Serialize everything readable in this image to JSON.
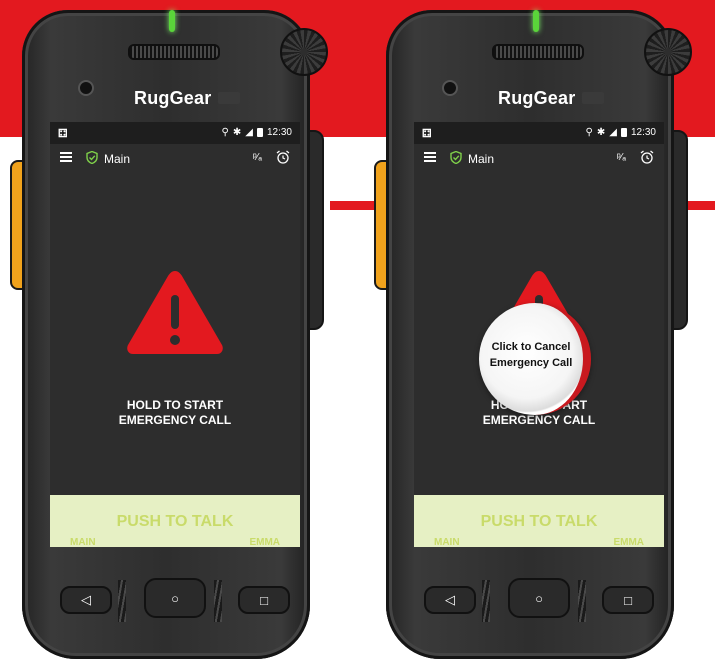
{
  "brand": "RugGear",
  "status_bar": {
    "left_icon": "⚃",
    "time": "12:30"
  },
  "app_bar": {
    "title": "Main"
  },
  "emergency": {
    "hold_text_line1": "HOLD TO START",
    "hold_text_line2": "EMERGENCY CALL"
  },
  "cancel": {
    "line1": "Click to Cancel",
    "line2": "Emergency Call"
  },
  "ptt": {
    "label": "PUSH TO TALK",
    "left": "MAIN",
    "right": "EMMA"
  },
  "colors": {
    "brand_red": "#e3191f",
    "warning_red": "#e3191f",
    "ptt_bg": "#e6f0c4",
    "ptt_text": "#c9db6a",
    "led_green": "#5ad53a"
  },
  "nav": {
    "back": "◁",
    "home": "○",
    "recent": "□"
  }
}
